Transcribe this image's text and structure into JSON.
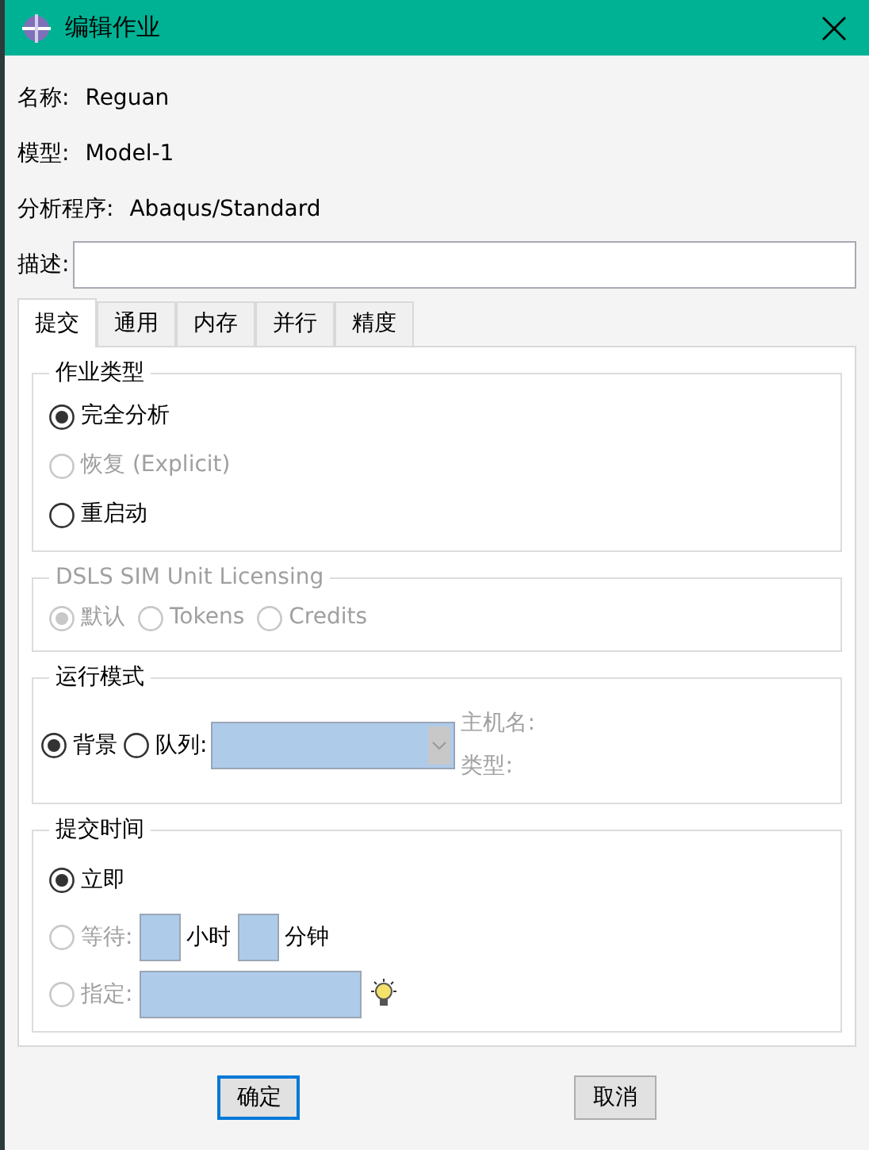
{
  "window": {
    "title": "编辑作业"
  },
  "info": [
    {
      "label": "名称:",
      "value": "Reguan"
    },
    {
      "label": "模型:",
      "value": "Model-1"
    },
    {
      "label": "分析程序:",
      "value": "Abaqus/Standard"
    }
  ],
  "description": {
    "label": "描述:"
  },
  "tabs": [
    {
      "label": "提交",
      "selected": true
    },
    {
      "label": "通用",
      "selected": false
    },
    {
      "label": "内存",
      "selected": false
    },
    {
      "label": "并行",
      "selected": false
    },
    {
      "label": "精度",
      "selected": false
    }
  ],
  "job_type": {
    "title": "作业类型",
    "disabled": false,
    "options": [
      {
        "label": "完全分析",
        "selected": true,
        "disabled": false
      },
      {
        "label": "恢复 (Explicit)",
        "selected": false,
        "disabled": true
      },
      {
        "label": "重启动",
        "selected": false,
        "disabled": false
      }
    ]
  },
  "licensing": {
    "title": "DSLS SIM Unit Licensing",
    "disabled": true,
    "options": [
      {
        "label": "默认",
        "selected": true,
        "disabled": true
      },
      {
        "label": "Tokens",
        "selected": false,
        "disabled": true
      },
      {
        "label": "Credits",
        "selected": false,
        "disabled": true
      }
    ]
  },
  "run_mode": {
    "title": "运行模式",
    "options": [
      {
        "label": "背景",
        "selected": true,
        "disabled": false,
        "kind": "plain"
      },
      {
        "label": "队列:",
        "selected": false,
        "disabled": false,
        "kind": "queue"
      }
    ],
    "host_label": "主机名:",
    "type_label": "类型:"
  },
  "submit_time": {
    "title": "提交时间",
    "options": [
      {
        "kind": "plain",
        "label": "立即",
        "selected": true,
        "disabled": false
      },
      {
        "kind": "wait",
        "label": "等待:",
        "selected": false,
        "disabled": true,
        "hours_unit": "小时",
        "minutes_unit": "分钟"
      },
      {
        "kind": "at",
        "label": "指定:",
        "selected": false,
        "disabled": true
      }
    ]
  },
  "buttons": [
    {
      "label": "确定",
      "focused": true
    },
    {
      "label": "取消",
      "focused": false
    }
  ]
}
